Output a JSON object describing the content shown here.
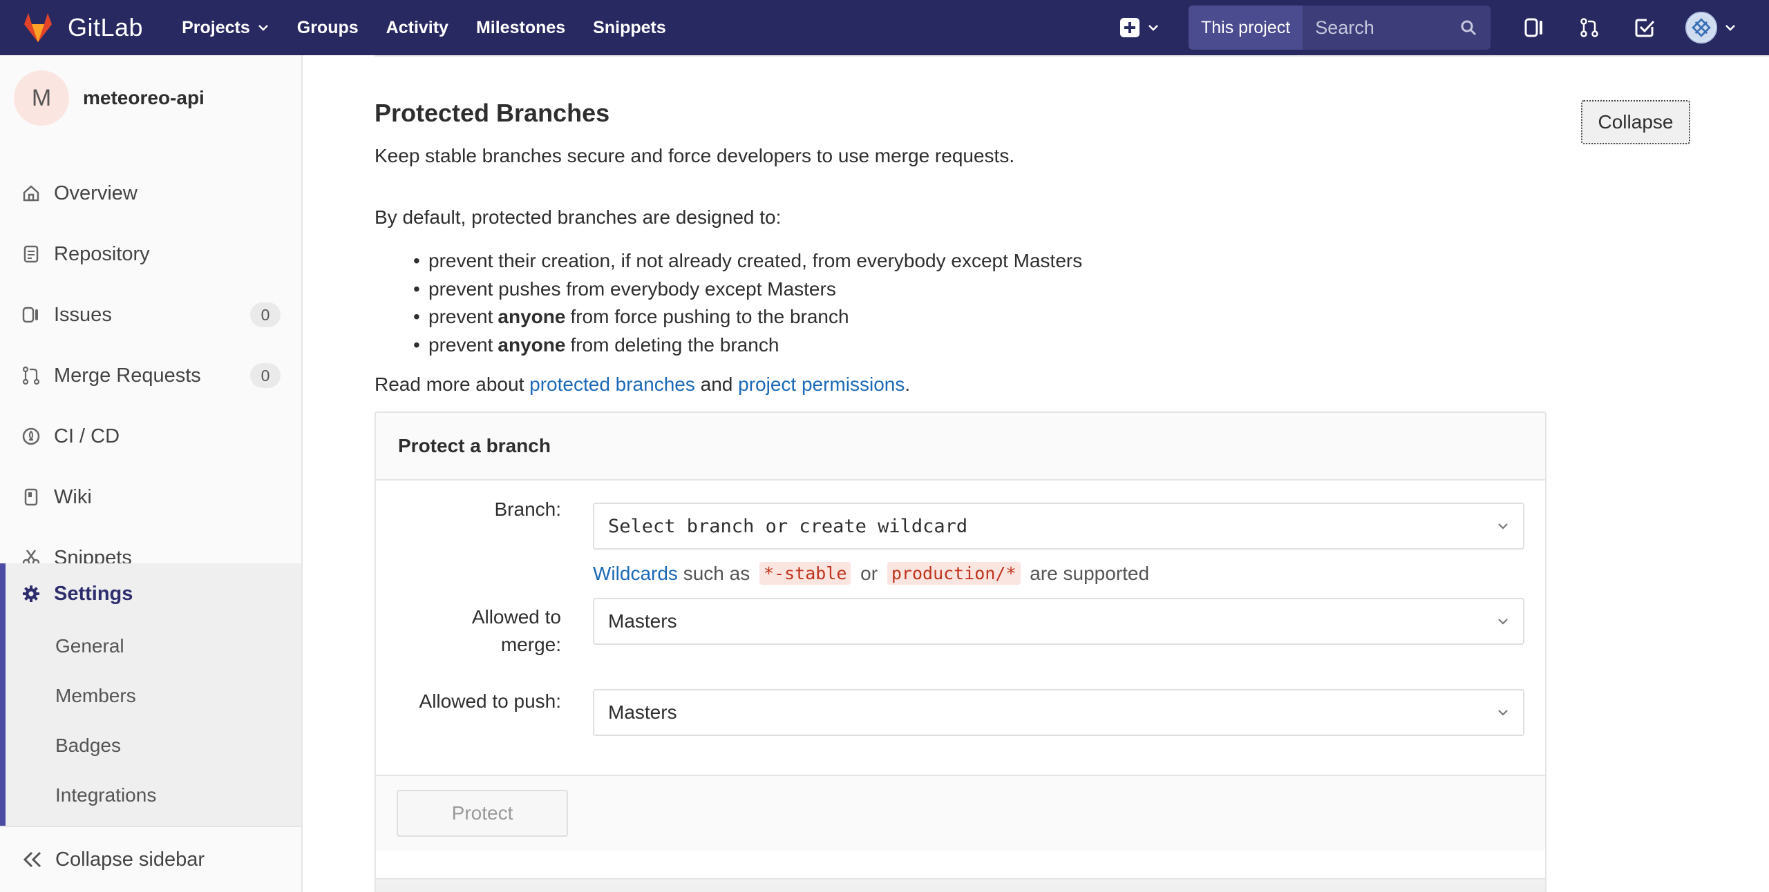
{
  "navbar": {
    "brand": "GitLab",
    "links": [
      "Projects",
      "Groups",
      "Activity",
      "Milestones",
      "Snippets"
    ],
    "search_scope": "This project",
    "search_placeholder": "Search"
  },
  "sidebar": {
    "project_initial": "M",
    "project_name": "meteoreo-api",
    "items": [
      {
        "label": "Overview",
        "icon": "home-icon"
      },
      {
        "label": "Repository",
        "icon": "repository-icon"
      },
      {
        "label": "Issues",
        "icon": "issues-icon",
        "count": "0"
      },
      {
        "label": "Merge Requests",
        "icon": "merge-request-icon",
        "count": "0"
      },
      {
        "label": "CI / CD",
        "icon": "rocket-icon"
      },
      {
        "label": "Wiki",
        "icon": "book-icon"
      },
      {
        "label": "Snippets",
        "icon": "scissors-icon"
      }
    ],
    "settings_label": "Settings",
    "settings_sub": [
      "General",
      "Members",
      "Badges",
      "Integrations"
    ],
    "collapse_label": "Collapse sidebar"
  },
  "section": {
    "title": "Protected Branches",
    "collapse_label": "Collapse",
    "description": "Keep stable branches secure and force developers to use merge requests.",
    "default_lead": "By default, protected branches are designed to:",
    "rules": [
      {
        "pre": "prevent their creation, if not already created, from everybody except Masters",
        "bold": "",
        "post": ""
      },
      {
        "pre": "prevent pushes from everybody except Masters",
        "bold": "",
        "post": ""
      },
      {
        "pre": "prevent",
        "bold": "anyone",
        "post": "from force pushing to the branch"
      },
      {
        "pre": "prevent",
        "bold": "anyone",
        "post": "from deleting the branch"
      }
    ],
    "read_more_prefix": "Read more about ",
    "link_protected": "protected branches",
    "read_more_and": " and ",
    "link_permissions": "project permissions",
    "read_more_suffix": "."
  },
  "protect_form": {
    "heading": "Protect a branch",
    "branch_label": "Branch:",
    "branch_placeholder": "Select branch or create wildcard",
    "hint_link": "Wildcards",
    "hint_such_as": " such as ",
    "hint_example1": "*-stable",
    "hint_or": " or ",
    "hint_example2": "production/*",
    "hint_supported": " are supported",
    "merge_label": "Allowed to merge:",
    "merge_value": "Masters",
    "push_label": "Allowed to push:",
    "push_value": "Masters",
    "protect_button": "Protect"
  },
  "colors": {
    "navbar": "#292961",
    "accent": "#4b4ba3",
    "link": "#1b69b6",
    "code": "#c0341d"
  }
}
